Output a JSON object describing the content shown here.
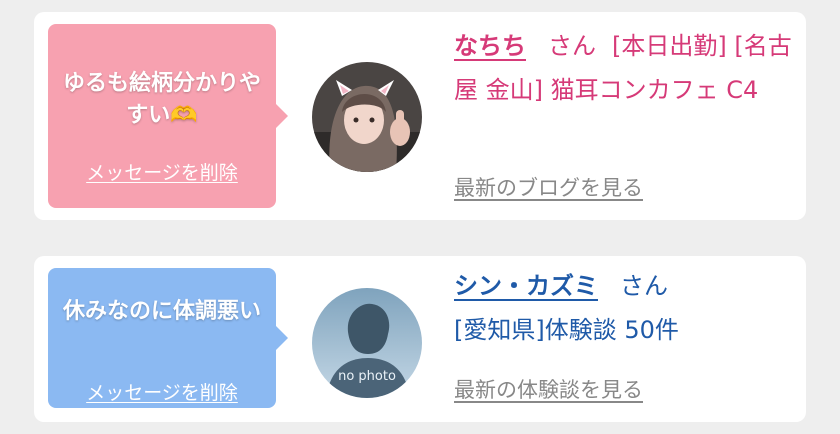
{
  "cards": [
    {
      "message_text": "ゆるも絵柄分かりやすい",
      "message_emoji": "🫶",
      "delete_label": "メッセージを削除",
      "name": "なちち",
      "honorific": "さん",
      "detail": "[本日出勤] [名古屋 金山] 猫耳コンカフェ C4",
      "link_label": "最新のブログを見る",
      "avatar_icon": "profile-photo-cat-ears",
      "bubble_color": "#f7a1b0",
      "name_color": "#d63a78"
    },
    {
      "message_text": "休みなのに体調悪い",
      "message_emoji": "",
      "delete_label": "メッセージを削除",
      "name": "シン・カズミ",
      "honorific": "さん",
      "detail": "[愛知県]体験談 50件",
      "link_label": "最新の体験談を見る",
      "avatar_text": "no photo",
      "avatar_icon": "no-photo-silhouette",
      "bubble_color": "#8bb9f2",
      "name_color": "#1f5aa8"
    }
  ]
}
